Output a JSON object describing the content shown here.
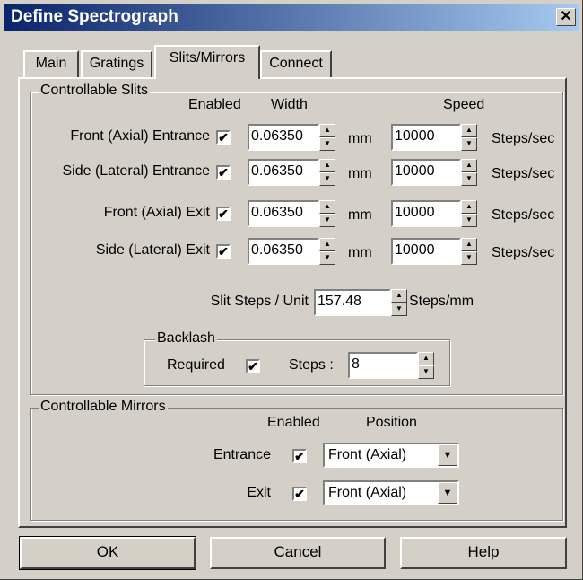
{
  "window": {
    "title": "Define Spectrograph",
    "close_glyph": "✕"
  },
  "tabs": [
    {
      "label": "Main"
    },
    {
      "label": "Gratings"
    },
    {
      "label": "Slits/Mirrors",
      "active": true
    },
    {
      "label": "Connect"
    }
  ],
  "slits": {
    "group_title": "Controllable Slits",
    "col_enabled": "Enabled",
    "col_width": "Width",
    "col_speed": "Speed",
    "width_unit": "mm",
    "speed_unit": "Steps/sec",
    "rows": [
      {
        "label": "Front (Axial) Entrance",
        "enabled": "✔",
        "width": "0.06350",
        "speed": "10000"
      },
      {
        "label": "Side (Lateral) Entrance",
        "enabled": "✔",
        "width": "0.06350",
        "speed": "10000"
      },
      {
        "label": "Front (Axial) Exit",
        "enabled": "✔",
        "width": "0.06350",
        "speed": "10000"
      },
      {
        "label": "Side (Lateral) Exit",
        "enabled": "✔",
        "width": "0.06350",
        "speed": "10000"
      }
    ],
    "steps_per_unit_label": "Slit Steps / Unit",
    "steps_per_unit_value": "157.48",
    "steps_per_unit_unit": "Steps/mm"
  },
  "backlash": {
    "group_title": "Backlash",
    "required_label": "Required",
    "required_checked": "✔",
    "steps_label": "Steps :",
    "steps_value": "8"
  },
  "mirrors": {
    "group_title": "Controllable Mirrors",
    "col_enabled": "Enabled",
    "col_position": "Position",
    "rows": [
      {
        "label": "Entrance",
        "enabled": "✔",
        "position": "Front (Axial)"
      },
      {
        "label": "Exit",
        "enabled": "✔",
        "position": "Front (Axial)"
      }
    ]
  },
  "buttons": {
    "ok": "OK",
    "cancel": "Cancel",
    "help": "Help"
  },
  "glyphs": {
    "spin_up": "▲",
    "spin_down": "▼",
    "dropdown": "▼"
  }
}
